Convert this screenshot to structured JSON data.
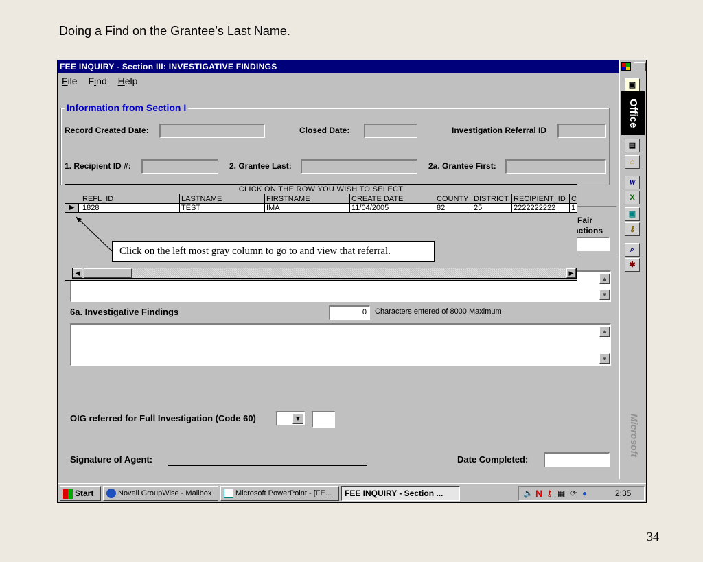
{
  "slide": {
    "title": "Doing a Find on the Grantee’s Last Name.",
    "page_number": "34"
  },
  "window": {
    "title": "FEE INQUIRY - Section III:  INVESTIGATIVE FINDINGS"
  },
  "menu": {
    "items": [
      "File",
      "Find",
      "Help"
    ]
  },
  "section1": {
    "legend": "Information from Section I",
    "record_created_label": "Record Created Date:",
    "closed_date_label": "Closed Date:",
    "referral_id_label": "Investigation Referral ID",
    "recipient_id_label": "1.  Recipient ID #:",
    "grantee_last_label": "2. Grantee Last:",
    "grantee_first_label": "2a. Grantee First:"
  },
  "results_grid": {
    "caption": "CLICK ON THE ROW YOU WISH TO SELECT",
    "headers": [
      "REFL_ID",
      "LASTNAME",
      "FIRSTNAME",
      "CREATE DATE",
      "COUNTY",
      "DISTRICT",
      "RECIPIENT_ID",
      "C"
    ],
    "row": [
      "1828",
      "TEST",
      "IMA",
      "11/04/2005",
      "82",
      "25",
      "2222222222",
      "1"
    ]
  },
  "callout": "Click on the left most gray column to go to and view that referral.",
  "partial_labels": {
    "fair": "Fair",
    "actions": "actions"
  },
  "findings": {
    "label": "6a.  Investigative Findings",
    "char_count": "0",
    "char_note": "Characters entered of 8000 Maximum"
  },
  "oig": {
    "label": "OIG referred for Full Investigation (Code 60)"
  },
  "signature": {
    "agent_label": "Signature of Agent:",
    "date_completed_label": "Date Completed:"
  },
  "office_bar": {
    "label": "Office",
    "brand": "Microsoft"
  },
  "taskbar": {
    "start": "Start",
    "tasks": [
      "Novell GroupWise - Mailbox",
      "Microsoft PowerPoint - [FE...",
      "FEE INQUIRY - Section ..."
    ],
    "clock": "2:35 PM"
  }
}
